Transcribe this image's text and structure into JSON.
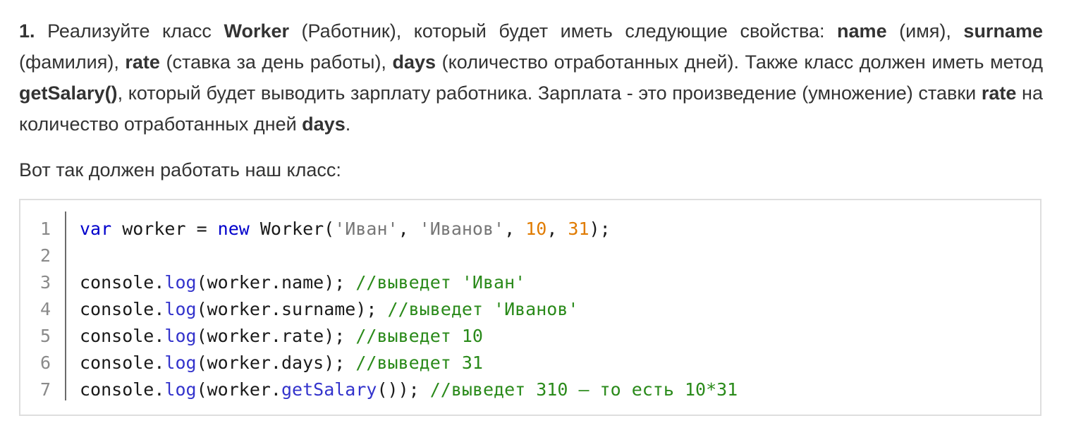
{
  "task": {
    "number": "1.",
    "t1": " Реализуйте класс ",
    "b_worker": "Worker",
    "t2": " (Работник), который будет иметь следующие свойства: ",
    "b_name": "name",
    "t3": " (имя), ",
    "b_surname": "surname",
    "t4": " (фамилия), ",
    "b_rate": "rate",
    "t5": " (ставка за день работы), ",
    "b_days": "days",
    "t6": " (количество отработанных дней). Также класс должен иметь метод ",
    "b_getsalary": "getSalary()",
    "t7": ", который будет выводить зарплату работника. Зарплата - это произве­дение (умножение) ставки ",
    "b_rate2": "rate",
    "t8": " на количество отработанных дней ",
    "b_days2": "days",
    "t9": "."
  },
  "intro": "Вот так должен работать наш класс:",
  "code": {
    "lines": [
      {
        "num": "1",
        "tokens": [
          {
            "t": "kw",
            "v": "var"
          },
          {
            "t": "pl",
            "v": " worker = "
          },
          {
            "t": "kw",
            "v": "new"
          },
          {
            "t": "pl",
            "v": " Worker("
          },
          {
            "t": "str",
            "v": "'Иван'"
          },
          {
            "t": "pl",
            "v": ", "
          },
          {
            "t": "str",
            "v": "'Иванов'"
          },
          {
            "t": "pl",
            "v": ", "
          },
          {
            "t": "num",
            "v": "10"
          },
          {
            "t": "pl",
            "v": ", "
          },
          {
            "t": "num",
            "v": "31"
          },
          {
            "t": "pl",
            "v": ");"
          }
        ]
      },
      {
        "num": "2",
        "tokens": []
      },
      {
        "num": "3",
        "tokens": [
          {
            "t": "pl",
            "v": "console."
          },
          {
            "t": "fn",
            "v": "log"
          },
          {
            "t": "pl",
            "v": "(worker.name); "
          },
          {
            "t": "cm",
            "v": "//выведет 'Иван'"
          }
        ]
      },
      {
        "num": "4",
        "tokens": [
          {
            "t": "pl",
            "v": "console."
          },
          {
            "t": "fn",
            "v": "log"
          },
          {
            "t": "pl",
            "v": "(worker.surname); "
          },
          {
            "t": "cm",
            "v": "//выведет 'Иванов'"
          }
        ]
      },
      {
        "num": "5",
        "tokens": [
          {
            "t": "pl",
            "v": "console."
          },
          {
            "t": "fn",
            "v": "log"
          },
          {
            "t": "pl",
            "v": "(worker.rate); "
          },
          {
            "t": "cm",
            "v": "//выведет 10"
          }
        ]
      },
      {
        "num": "6",
        "tokens": [
          {
            "t": "pl",
            "v": "console."
          },
          {
            "t": "fn",
            "v": "log"
          },
          {
            "t": "pl",
            "v": "(worker.days); "
          },
          {
            "t": "cm",
            "v": "//выведет 31"
          }
        ]
      },
      {
        "num": "7",
        "tokens": [
          {
            "t": "pl",
            "v": "console."
          },
          {
            "t": "fn",
            "v": "log"
          },
          {
            "t": "pl",
            "v": "(worker."
          },
          {
            "t": "fn",
            "v": "getSalary"
          },
          {
            "t": "pl",
            "v": "()); "
          },
          {
            "t": "cm",
            "v": "//выведет 310 — то есть 10*31"
          }
        ]
      }
    ]
  }
}
